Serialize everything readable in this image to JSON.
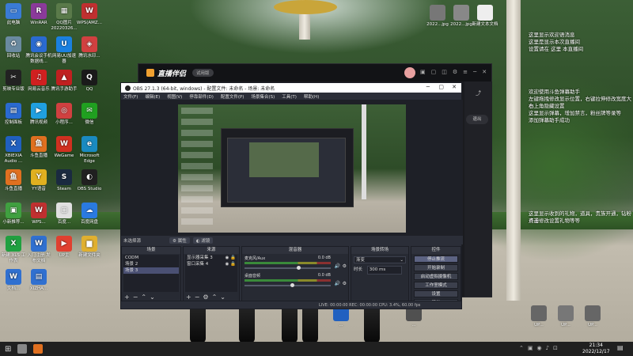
{
  "desktop": {
    "icons_left": [
      {
        "label": "此电脑",
        "color": "#3a7bd5",
        "glyph": "▭"
      },
      {
        "label": "WinRAR",
        "color": "#8a3a9a",
        "glyph": "R"
      },
      {
        "label": "QQ图片20220326...",
        "color": "#5a7a4a",
        "glyph": "▦"
      },
      {
        "label": "WPS(AMZ...",
        "color": "#c03030",
        "glyph": "W"
      },
      {
        "label": "回收站",
        "color": "#6a8aa0",
        "glyph": "♻"
      },
      {
        "label": "腾讯会议手机数据线...",
        "color": "#2a6ad0",
        "glyph": "◉"
      },
      {
        "label": "网易UU加速器",
        "color": "#1a80e0",
        "glyph": "U"
      },
      {
        "label": "腾讯水印...",
        "color": "#d04040",
        "glyph": "◈"
      },
      {
        "label": "剪映专业版",
        "color": "#222222",
        "glyph": "✂"
      },
      {
        "label": "网易云音乐",
        "color": "#d02020",
        "glyph": "♫"
      },
      {
        "label": "腾讯手游助手",
        "color": "#c02020",
        "glyph": "▲"
      },
      {
        "label": "QQ",
        "color": "#1a1a1a",
        "glyph": "Q"
      },
      {
        "label": "控制面板",
        "color": "#2a6ad0",
        "glyph": "▤"
      },
      {
        "label": "腾讯视频",
        "color": "#20a0e0",
        "glyph": "▶"
      },
      {
        "label": "小程序...",
        "color": "#d04040",
        "glyph": "◎"
      },
      {
        "label": "微信",
        "color": "#20a020",
        "glyph": "✉"
      },
      {
        "label": "XBIEXIA Audio ...",
        "color": "#2060c0",
        "glyph": "X"
      },
      {
        "label": "斗鱼直播",
        "color": "#e07020",
        "glyph": "鱼"
      },
      {
        "label": "WeGame",
        "color": "#d03020",
        "glyph": "W"
      },
      {
        "label": "Microsoft Edge",
        "color": "#1a8ac0",
        "glyph": "e"
      },
      {
        "label": "斗鱼直播",
        "color": "#e07020",
        "glyph": "鱼"
      },
      {
        "label": "YY语音",
        "color": "#e0b020",
        "glyph": "Y"
      },
      {
        "label": "Steam",
        "color": "#1a2a40",
        "glyph": "S"
      },
      {
        "label": "OBS Studio",
        "color": "#202020",
        "glyph": "◐"
      },
      {
        "label": "小新推荐...",
        "color": "#40a040",
        "glyph": "▣"
      },
      {
        "label": "WPS...",
        "color": "#c03030",
        "glyph": "W"
      },
      {
        "label": "百度...",
        "color": "#e0e0e0",
        "glyph": "▢"
      },
      {
        "label": "百度网盘",
        "color": "#2a7ae0",
        "glyph": "☁"
      },
      {
        "label": "新建 XLS 工作表",
        "color": "#20a040",
        "glyph": "X"
      },
      {
        "label": "入门注册 发布文档",
        "color": "#3070d0",
        "glyph": "W"
      },
      {
        "label": "UP主",
        "color": "#e04030",
        "glyph": "▶"
      },
      {
        "label": "新建文件夹",
        "color": "#e0b030",
        "glyph": "▆"
      },
      {
        "label": "文档...",
        "color": "#3070d0",
        "glyph": "W"
      },
      {
        "label": "XIZHA...",
        "color": "#3070d0",
        "glyph": "▤"
      }
    ],
    "icons_top_right": [
      {
        "label": "2022...jpg",
        "color": "#777777"
      },
      {
        "label": "2022...jpg",
        "color": "#888888"
      },
      {
        "label": "新建文本文档",
        "color": "#eeeeee"
      }
    ],
    "icons_bottom_right": [
      {
        "label": "UP...",
        "color": "#666666"
      },
      {
        "label": "UP...",
        "color": "#777777"
      },
      {
        "label": "UP...",
        "color": "#666666"
      }
    ],
    "icons_bottom_mid": [
      {
        "label": "...",
        "color": "#2060c0"
      },
      {
        "label": "...",
        "color": "#505050"
      }
    ]
  },
  "chat_overlay": {
    "top": [
      "这里显示欢迎语消息",
      "这里是显示本次直播间",
      "设置请在 这里 本直播间"
    ],
    "middle": [
      "欢迎使用斗鱼弹幕助手",
      "左键拖拽修改显示位置，右键拉伸修改宽度大小",
      "右上角隐藏设置",
      "这里显示弹幕，增加禁言，粉丝牌等录等",
      "添加弹幕助手成功"
    ],
    "bottom": [
      "这里显示收到的礼物，道具，贵族开通，钻粉开通",
      "点击修改设置礼物等等"
    ]
  },
  "helper_window": {
    "title": "直播伴侣",
    "badge": "试用版",
    "side_button": "退出"
  },
  "obs": {
    "title": "OBS 27.1.3 (64-bit, windows) - 配置文件: 未命名 - 场景: 未命名",
    "menu": [
      "文件(F)",
      "编辑(E)",
      "视图(V)",
      "停靠部件(D)",
      "配置文件(P)",
      "场景集合(S)",
      "工具(T)",
      "帮助(H)"
    ],
    "controls_bar": {
      "no_source": "未选择源",
      "properties": "属性",
      "filters": "滤镜"
    },
    "scenes": {
      "header": "场景",
      "items": [
        "CODM",
        "场景 2",
        "场景 3"
      ],
      "selected": 2
    },
    "sources": {
      "header": "来源",
      "items": [
        "显示器采集 3",
        "窗口采集 4"
      ]
    },
    "mixer": {
      "header": "混音器",
      "tracks": [
        {
          "name": "麦克风/Aux",
          "db": "0.0 dB",
          "level": 0.62
        },
        {
          "name": "桌面音频",
          "db": "0.0 dB",
          "level": 0.55
        }
      ]
    },
    "transitions": {
      "header": "场景转场",
      "type": "渐变",
      "duration_label": "时长",
      "duration_value": "300 ms"
    },
    "controls": {
      "header": "控件",
      "buttons": [
        "停止推流",
        "开始录制",
        "启动虚拟摄像机",
        "工作室模式",
        "设置",
        "退出"
      ]
    },
    "status": "LIVE: 00:00:00    REC: 00:00:00    CPU: 3.4%, 60.00 fps"
  },
  "taskbar": {
    "time": "21:34",
    "date": "2022/12/17",
    "pinned_colors": [
      "#888888",
      "#e07020"
    ]
  }
}
